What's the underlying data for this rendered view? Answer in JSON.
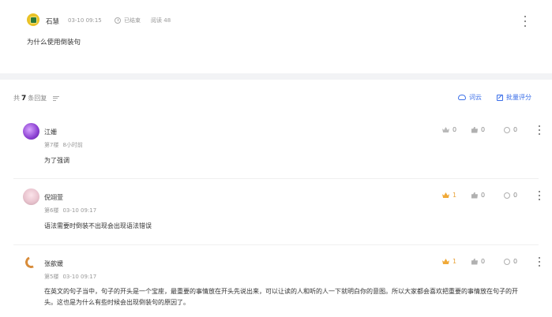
{
  "post": {
    "author": "石慧",
    "time": "03-10 09:15",
    "status": "已结束",
    "reads_label": "阅读",
    "reads_count": "48",
    "question": "为什么使用倒装句"
  },
  "replies_header": {
    "prefix": "共",
    "count": "7",
    "suffix": "条回复",
    "cloud_label": "词云",
    "score_label": "批量评分"
  },
  "replies": [
    {
      "name": "江姗",
      "floor": "第7楼",
      "time": "8小时前",
      "content": "为了强调",
      "crown": "0",
      "likes": "0",
      "comments": "0"
    },
    {
      "name": "倪翊萱",
      "floor": "第6楼",
      "time": "03-10 09:17",
      "content": "语法需要时倒装不出现会出现语法错误",
      "crown": "1",
      "likes": "0",
      "comments": "0"
    },
    {
      "name": "张歆媛",
      "floor": "第5楼",
      "time": "03-10 09:17",
      "content": "在英文的句子当中，句子的开头是一个宝座，最重要的事情放在开头先说出来，可以让读的人和听的人一下就明白你的意图。所以大家都会喜欢把重要的事情放在句子的开头。这也是为什么有些时候会出现倒装句的原因了。",
      "crown": "1",
      "likes": "0",
      "comments": "0"
    }
  ],
  "colors": {
    "accent": "#3a6ee8",
    "crown_gold": "#f0a938",
    "page_bg": "#f2f3f5"
  }
}
